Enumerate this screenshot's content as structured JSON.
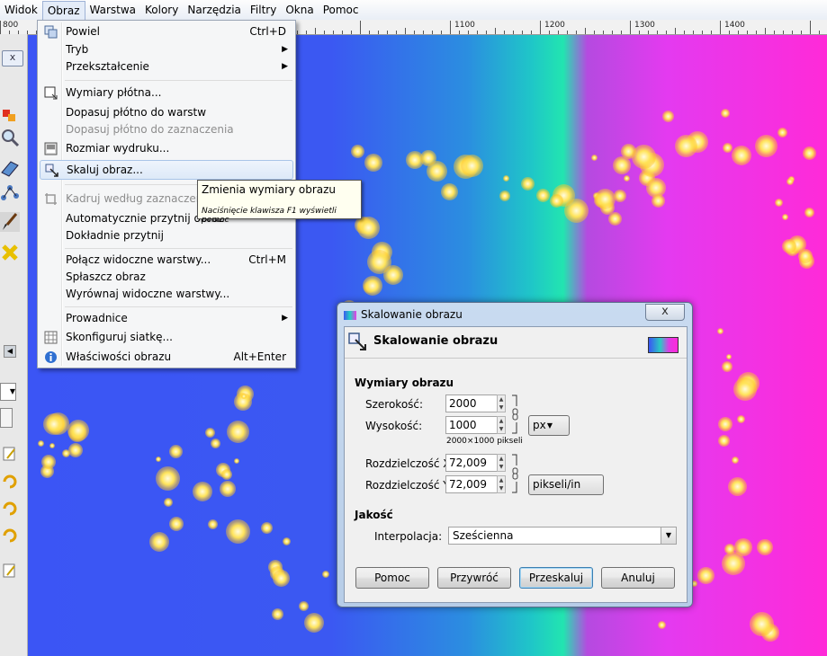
{
  "menubar": {
    "items": [
      "Widok",
      "Obraz",
      "Warstwa",
      "Kolory",
      "Narzędzia",
      "Filtry",
      "Okna",
      "Pomoc"
    ]
  },
  "ruler": {
    "ticks": [
      "800",
      "1100",
      "1200",
      "1300",
      "1400"
    ]
  },
  "image_menu": {
    "items": [
      {
        "label": "Powiel",
        "accel": "Ctrl+D",
        "icon": "duplicate-icon"
      },
      {
        "label": "Tryb",
        "submenu": true
      },
      {
        "label": "Przekształcenie",
        "submenu": true
      },
      {
        "label": "Wymiary płótna...",
        "icon": "canvas-size-icon"
      },
      {
        "label": "Dopasuj płótno do warstw"
      },
      {
        "label": "Dopasuj płótno do zaznaczenia",
        "disabled": true
      },
      {
        "label": "Rozmiar wydruku...",
        "icon": "print-size-icon"
      },
      {
        "label": "Skaluj obraz...",
        "icon": "scale-image-icon",
        "highlighted": true
      },
      {
        "label": "Kadruj według zaznaczenia",
        "disabled": true,
        "icon": "crop-icon"
      },
      {
        "label": "Automatycznie przytnij obraz"
      },
      {
        "label": "Dokładnie przytnij"
      },
      {
        "label": "Połącz widoczne warstwy...",
        "accel": "Ctrl+M"
      },
      {
        "label": "Spłaszcz obraz"
      },
      {
        "label": "Wyrównaj widoczne warstwy..."
      },
      {
        "label": "Prowadnice",
        "submenu": true
      },
      {
        "label": "Skonfiguruj siatkę...",
        "icon": "grid-icon"
      },
      {
        "label": "Właściwości obrazu",
        "accel": "Alt+Enter",
        "icon": "info-icon"
      }
    ]
  },
  "tooltip": {
    "title": "Zmienia wymiary obrazu",
    "hint": "Naciśnięcie klawisza F1 wyświetli pomoc"
  },
  "dialog": {
    "window_title": "Skalowanie obrazu",
    "close_glyph": "x",
    "header_title": "Skalowanie obrazu",
    "size_section": "Wymiary obrazu",
    "width_label": "Szerokość:",
    "width_value": "2000",
    "height_label": "Wysokość:",
    "height_value": "1000",
    "size_note": "2000×1000 pikseli",
    "size_unit": "px",
    "res_x_label": "Rozdzielczość X:",
    "res_x_value": "72,009",
    "res_y_label": "Rozdzielczość Y:",
    "res_y_value": "72,009",
    "res_unit": "pikseli/in",
    "quality_section": "Jakość",
    "interp_label": "Interpolacja:",
    "interp_value": "Sześcienna",
    "buttons": {
      "help": "Pomoc",
      "reset": "Przywróć",
      "scale": "Przeskaluj",
      "cancel": "Anuluj"
    }
  }
}
